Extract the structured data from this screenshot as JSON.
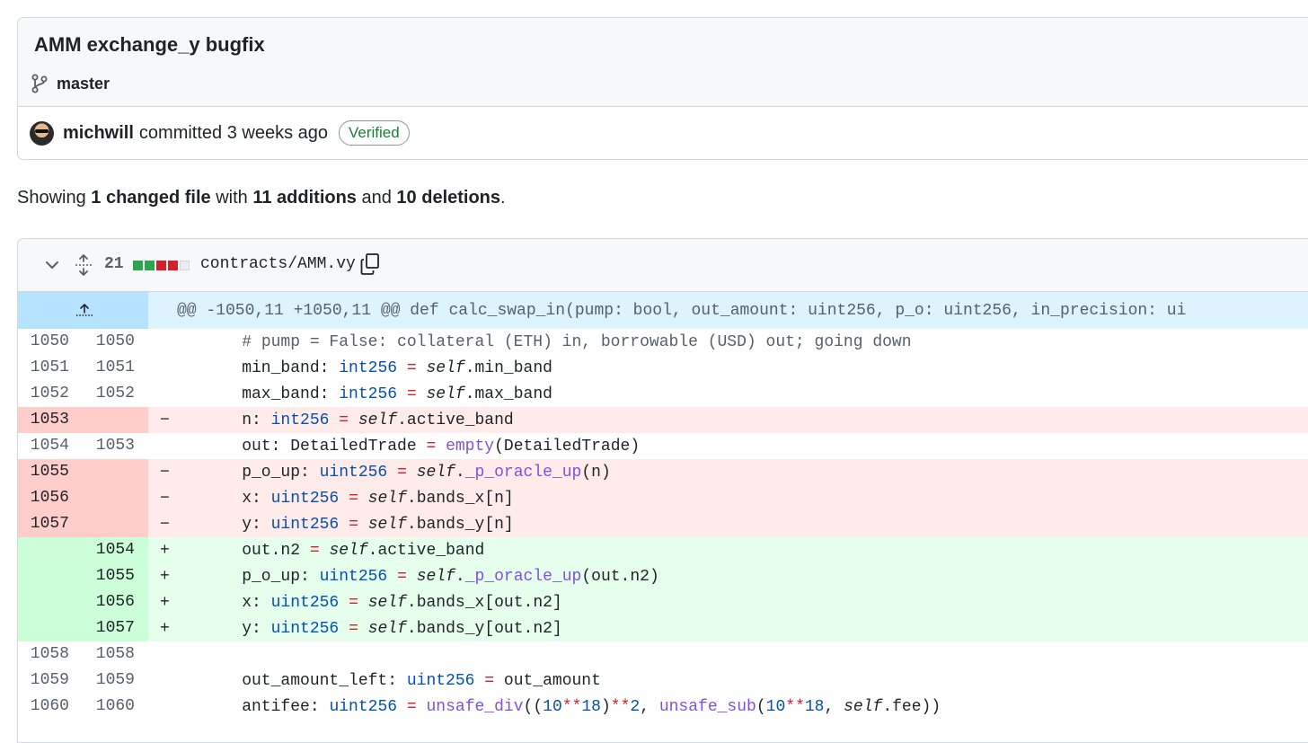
{
  "commit": {
    "title": "AMM exchange_y bugfix",
    "branch": "master",
    "author": "michwill",
    "action": "committed 3 weeks ago",
    "badge": "Verified"
  },
  "summary": {
    "prefix": "Showing ",
    "changed": "1 changed file",
    "with": " with ",
    "additions": "11 additions",
    "and": " and ",
    "deletions": "10 deletions",
    "end": "."
  },
  "file": {
    "changes_count": "21",
    "path": "contracts/AMM.vy",
    "diffstat_colors": [
      "#2da44e",
      "#2da44e",
      "#cf222e",
      "#cf222e",
      "#eaeef2"
    ]
  },
  "hunk_header": "@@ -1050,11 +1050,11 @@ def calc_swap_in(pump: bool, out_amount: uint256, p_o: uint256, in_precision: ui",
  "lines": [
    {
      "type": "ctx",
      "old": "1050",
      "new": "1050",
      "mark": "",
      "segs": [
        [
          "    ",
          ""
        ],
        [
          "# pump = False: collateral (ETH) in, borrowable (USD) out; going down",
          "cm"
        ]
      ]
    },
    {
      "type": "ctx",
      "old": "1051",
      "new": "1051",
      "mark": "",
      "segs": [
        [
          "    min_band: ",
          ""
        ],
        [
          "int256",
          "ty"
        ],
        [
          " ",
          ""
        ],
        [
          "=",
          "kw"
        ],
        [
          " ",
          ""
        ],
        [
          "self",
          "sf"
        ],
        [
          ".min_band",
          ""
        ]
      ]
    },
    {
      "type": "ctx",
      "old": "1052",
      "new": "1052",
      "mark": "",
      "segs": [
        [
          "    max_band: ",
          ""
        ],
        [
          "int256",
          "ty"
        ],
        [
          " ",
          ""
        ],
        [
          "=",
          "kw"
        ],
        [
          " ",
          ""
        ],
        [
          "self",
          "sf"
        ],
        [
          ".max_band",
          ""
        ]
      ]
    },
    {
      "type": "del",
      "old": "1053",
      "new": "",
      "mark": "−",
      "segs": [
        [
          "    n: ",
          ""
        ],
        [
          "int256",
          "ty"
        ],
        [
          " ",
          ""
        ],
        [
          "=",
          "kw"
        ],
        [
          " ",
          ""
        ],
        [
          "self",
          "sf"
        ],
        [
          ".active_band",
          ""
        ]
      ]
    },
    {
      "type": "ctx",
      "old": "1054",
      "new": "1053",
      "mark": "",
      "segs": [
        [
          "    out: DetailedTrade ",
          ""
        ],
        [
          "=",
          "kw"
        ],
        [
          " ",
          ""
        ],
        [
          "empty",
          "fn"
        ],
        [
          "(DetailedTrade)",
          ""
        ]
      ]
    },
    {
      "type": "del",
      "old": "1055",
      "new": "",
      "mark": "−",
      "segs": [
        [
          "    p_o_up: ",
          ""
        ],
        [
          "uint256",
          "ty"
        ],
        [
          " ",
          ""
        ],
        [
          "=",
          "kw"
        ],
        [
          " ",
          ""
        ],
        [
          "self",
          "sf"
        ],
        [
          ".",
          ""
        ],
        [
          "_p_oracle_up",
          "fn"
        ],
        [
          "(n)",
          ""
        ]
      ]
    },
    {
      "type": "del",
      "old": "1056",
      "new": "",
      "mark": "−",
      "segs": [
        [
          "    x: ",
          ""
        ],
        [
          "uint256",
          "ty"
        ],
        [
          " ",
          ""
        ],
        [
          "=",
          "kw"
        ],
        [
          " ",
          ""
        ],
        [
          "self",
          "sf"
        ],
        [
          ".bands_x[n]",
          ""
        ]
      ]
    },
    {
      "type": "del",
      "old": "1057",
      "new": "",
      "mark": "−",
      "segs": [
        [
          "    y: ",
          ""
        ],
        [
          "uint256",
          "ty"
        ],
        [
          " ",
          ""
        ],
        [
          "=",
          "kw"
        ],
        [
          " ",
          ""
        ],
        [
          "self",
          "sf"
        ],
        [
          ".bands_y[n]",
          ""
        ]
      ]
    },
    {
      "type": "add",
      "old": "",
      "new": "1054",
      "mark": "+",
      "segs": [
        [
          "    out.n2 ",
          ""
        ],
        [
          "=",
          "kw"
        ],
        [
          " ",
          ""
        ],
        [
          "self",
          "sf"
        ],
        [
          ".active_band",
          ""
        ]
      ]
    },
    {
      "type": "add",
      "old": "",
      "new": "1055",
      "mark": "+",
      "segs": [
        [
          "    p_o_up: ",
          ""
        ],
        [
          "uint256",
          "ty"
        ],
        [
          " ",
          ""
        ],
        [
          "=",
          "kw"
        ],
        [
          " ",
          ""
        ],
        [
          "self",
          "sf"
        ],
        [
          ".",
          ""
        ],
        [
          "_p_oracle_up",
          "fn"
        ],
        [
          "(out.n2)",
          ""
        ]
      ]
    },
    {
      "type": "add",
      "old": "",
      "new": "1056",
      "mark": "+",
      "segs": [
        [
          "    x: ",
          ""
        ],
        [
          "uint256",
          "ty"
        ],
        [
          " ",
          ""
        ],
        [
          "=",
          "kw"
        ],
        [
          " ",
          ""
        ],
        [
          "self",
          "sf"
        ],
        [
          ".bands_x[out.n2]",
          ""
        ]
      ]
    },
    {
      "type": "add",
      "old": "",
      "new": "1057",
      "mark": "+",
      "segs": [
        [
          "    y: ",
          ""
        ],
        [
          "uint256",
          "ty"
        ],
        [
          " ",
          ""
        ],
        [
          "=",
          "kw"
        ],
        [
          " ",
          ""
        ],
        [
          "self",
          "sf"
        ],
        [
          ".bands_y[out.n2]",
          ""
        ]
      ]
    },
    {
      "type": "ctx",
      "old": "1058",
      "new": "1058",
      "mark": "",
      "segs": [
        [
          "",
          ""
        ]
      ]
    },
    {
      "type": "ctx",
      "old": "1059",
      "new": "1059",
      "mark": "",
      "segs": [
        [
          "    out_amount_left: ",
          ""
        ],
        [
          "uint256",
          "ty"
        ],
        [
          " ",
          ""
        ],
        [
          "=",
          "kw"
        ],
        [
          " out_amount",
          ""
        ]
      ]
    },
    {
      "type": "ctx",
      "old": "1060",
      "new": "1060",
      "mark": "",
      "segs": [
        [
          "    antifee: ",
          ""
        ],
        [
          "uint256",
          "ty"
        ],
        [
          " ",
          ""
        ],
        [
          "=",
          "kw"
        ],
        [
          " ",
          ""
        ],
        [
          "unsafe_div",
          "fn"
        ],
        [
          "((",
          ""
        ],
        [
          "10",
          "nm"
        ],
        [
          "**",
          "kw"
        ],
        [
          "18",
          "nm"
        ],
        [
          ")",
          ""
        ],
        [
          "**",
          "kw"
        ],
        [
          "2",
          "nm"
        ],
        [
          ", ",
          ""
        ],
        [
          "unsafe_sub",
          "fn"
        ],
        [
          "(",
          ""
        ],
        [
          "10",
          "nm"
        ],
        [
          "**",
          "kw"
        ],
        [
          "18",
          "nm"
        ],
        [
          ", ",
          ""
        ],
        [
          "self",
          "sf"
        ],
        [
          ".fee))",
          ""
        ]
      ]
    }
  ]
}
